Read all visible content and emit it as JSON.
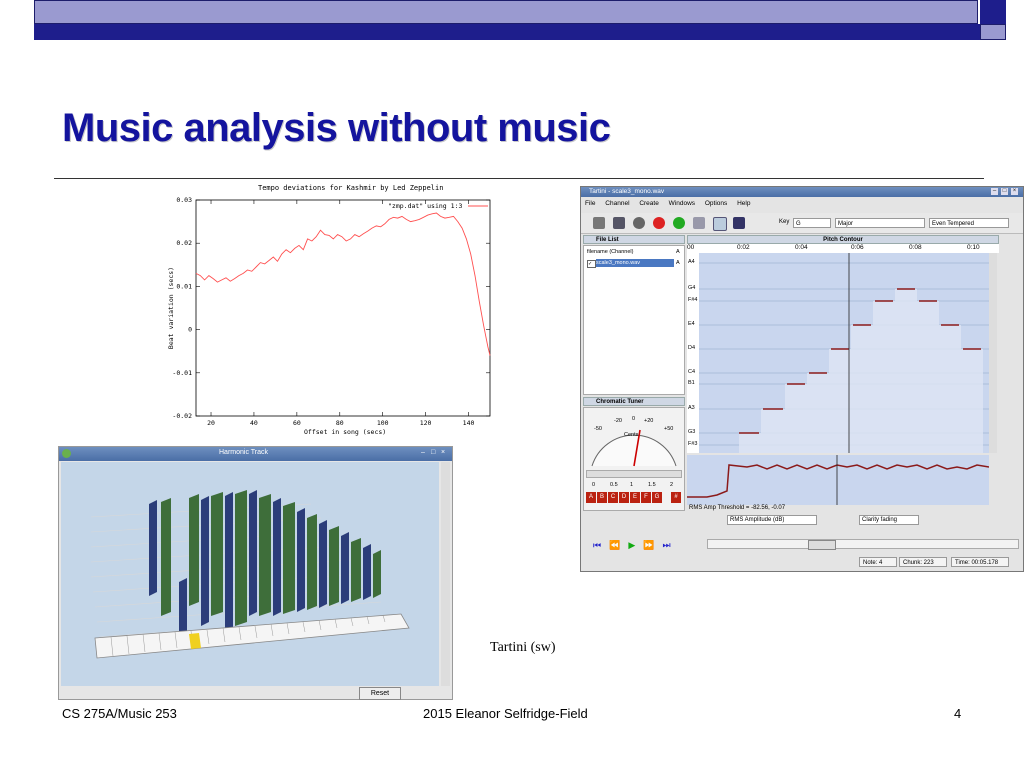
{
  "slide": {
    "title": "Music analysis without music",
    "caption": "Tartini (sw)",
    "footer_left": "CS 275A/Music 253",
    "footer_center": "2015 Eleanor Selfridge-Field",
    "footer_right": "4"
  },
  "colors": {
    "title": "#14149e",
    "bar_light": "#9a9ad0",
    "bar_dark": "#1e1e8c",
    "plot_line": "#ff5050"
  },
  "chart_data": {
    "type": "line",
    "title": "Tempo deviations for Kashmir by Led Zeppelin",
    "xlabel": "Offset in song (secs)",
    "ylabel": "Beat variation (secs)",
    "xlim": [
      13,
      150
    ],
    "ylim": [
      -0.02,
      0.03
    ],
    "xticks": [
      "20",
      "40",
      "60",
      "80",
      "100",
      "120",
      "140"
    ],
    "yticks": [
      "0.03",
      "0.02",
      "0.01",
      "0",
      "-0.01",
      "-0.02"
    ],
    "grid": false,
    "legend_position": "top-right",
    "series": [
      {
        "name": "\"zmp.dat\" using 1:3",
        "x": [
          13,
          15,
          17,
          19,
          21,
          23,
          25,
          27,
          29,
          31,
          33,
          35,
          37,
          39,
          41,
          43,
          45,
          47,
          49,
          51,
          53,
          55,
          57,
          59,
          61,
          63,
          65,
          67,
          69,
          71,
          73,
          75,
          77,
          79,
          81,
          83,
          85,
          87,
          89,
          91,
          93,
          95,
          97,
          99,
          101,
          103,
          105,
          107,
          109,
          111,
          113,
          115,
          117,
          119,
          121,
          123,
          125,
          127,
          129,
          131,
          133,
          135,
          137,
          139,
          141,
          143,
          145,
          147,
          149,
          150
        ],
        "y": [
          0.013,
          0.0125,
          0.0115,
          0.0125,
          0.0118,
          0.011,
          0.0115,
          0.012,
          0.0112,
          0.0118,
          0.0125,
          0.013,
          0.0138,
          0.0135,
          0.0145,
          0.0155,
          0.0152,
          0.016,
          0.0168,
          0.0158,
          0.0175,
          0.0185,
          0.0178,
          0.0188,
          0.0195,
          0.0185,
          0.021,
          0.0205,
          0.0215,
          0.023,
          0.022,
          0.0218,
          0.021,
          0.022,
          0.0215,
          0.0205,
          0.021,
          0.022,
          0.0215,
          0.0222,
          0.0228,
          0.0235,
          0.024,
          0.0238,
          0.0245,
          0.0255,
          0.026,
          0.0258,
          0.0262,
          0.0255,
          0.025,
          0.0252,
          0.0255,
          0.026,
          0.0265,
          0.0268,
          0.027,
          0.0262,
          0.0258,
          0.026,
          0.0262,
          0.025,
          0.0235,
          0.021,
          0.0175,
          0.0125,
          0.0065,
          0.001,
          -0.004,
          -0.006
        ]
      }
    ]
  },
  "harmonic_track": {
    "window_title": "Harmonic Track",
    "reset_label": "Reset",
    "icon": "app-icon"
  },
  "tartini": {
    "window_title": "Tartini - scale3_mono.wav",
    "menu": [
      "File",
      "Channel",
      "Create",
      "Windows",
      "Options",
      "Help"
    ],
    "key_label": "Key",
    "key_value": "G",
    "scale_value": "Major",
    "temperament_value": "Even Tempered",
    "file_list": {
      "title": "File List",
      "col_filename": "filename (Channel)",
      "col_a": "A",
      "row_file": "scale3_mono.wav",
      "row_a": "A"
    },
    "pitch_contour": {
      "title": "Pitch Contour",
      "time_ticks": [
        "00",
        "0:02",
        "0:04",
        "0:06",
        "0:08",
        "0:10"
      ],
      "notes": [
        "A4",
        "G4",
        "F#4",
        "E4",
        "D4",
        "C4",
        "B1",
        "A3",
        "G3",
        "F#3"
      ]
    },
    "tuner": {
      "title": "Chromatic Tuner",
      "dial_labels": [
        "-20",
        "0",
        "+20",
        "-50",
        "+50"
      ],
      "cents_label": "Cents",
      "scale_ticks": [
        "0",
        "0.5",
        "1",
        "1.5",
        "2"
      ],
      "note_buttons": [
        "A",
        "B",
        "C",
        "D",
        "E",
        "F",
        "G",
        "#"
      ]
    },
    "amp": {
      "threshold_text": "RMS Amp Threshold = -82.56, -0.07",
      "mode_value": "RMS Amplitude (dB)",
      "fade_value": "Clarity fading"
    },
    "status": {
      "note": "Note: 4",
      "chunk": "Chunk: 223",
      "time": "Time:  00:05.178"
    }
  }
}
